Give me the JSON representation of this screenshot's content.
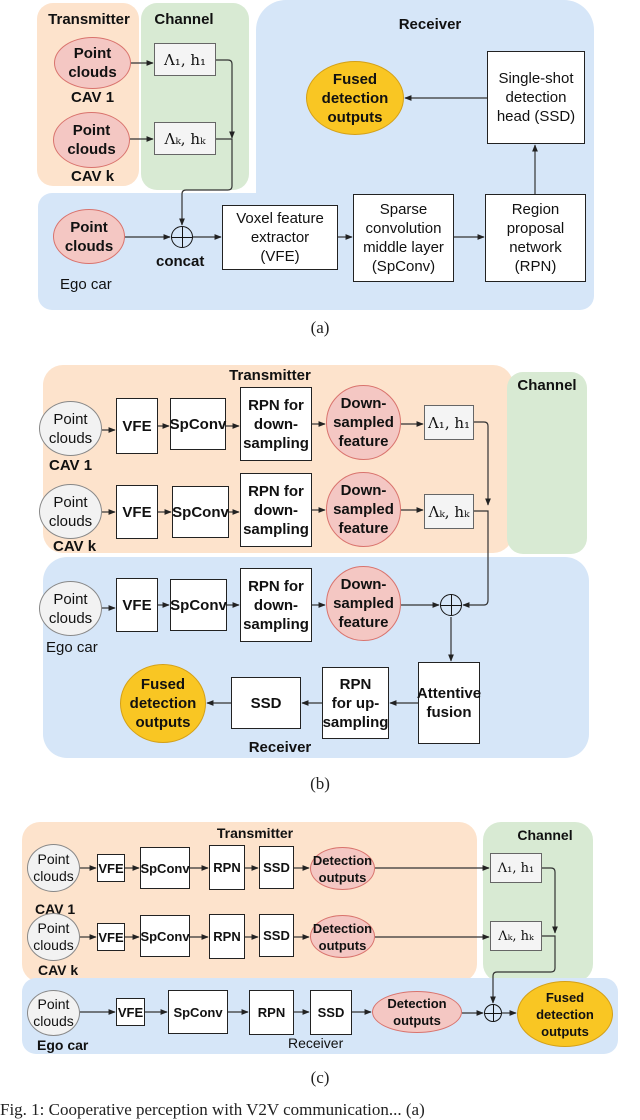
{
  "figure_caption_partial": "Fig. 1: Cooperative perception with V2V communication... (a)",
  "panel_a": {
    "caption": "(a)",
    "transmitter_title": "Transmitter",
    "channel_title": "Channel",
    "receiver_title": "Receiver",
    "cav1_node": "Point\nclouds",
    "cav1_label": "CAV 1",
    "cavk_node": "Point\nclouds",
    "cavk_label": "CAV k",
    "lambda1": "Λ₁, h₁",
    "lambdak": "Λₖ, hₖ",
    "ego_node": "Point\nclouds",
    "ego_label": "Ego car",
    "concat_label": "concat",
    "vfe": "Voxel feature\nextractor\n(VFE)",
    "spconv": "Sparse\nconvolution\nmiddle layer\n(SpConv)",
    "rpn": "Region\nproposal\nnetwork\n(RPN)",
    "ssd": "Single-shot\ndetection\nhead (SSD)",
    "output": "Fused\ndetection\noutputs"
  },
  "panel_b": {
    "caption": "(b)",
    "transmitter_title": "Transmitter",
    "channel_title": "Channel",
    "receiver_title": "Receiver",
    "point_clouds": "Point\nclouds",
    "cav1_label": "CAV 1",
    "cavk_label": "CAV k",
    "ego_label": "Ego car",
    "vfe": "VFE",
    "spconv": "SpConv",
    "rpn_down": "RPN for\ndown-\nsampling",
    "down_feature": "Down-\nsampled\nfeature",
    "lambda1": "Λ₁, h₁",
    "lambdak": "Λₖ, hₖ",
    "attentive": "Attentive\nfusion",
    "rpn_up": "RPN\nfor up-\nsampling",
    "ssd": "SSD",
    "output": "Fused\ndetection\noutputs"
  },
  "panel_c": {
    "caption": "(c)",
    "transmitter_title": "Transmitter",
    "channel_title": "Channel",
    "receiver_title": "Receiver",
    "point_clouds": "Point\nclouds",
    "cav1_label": "CAV 1",
    "cavk_label": "CAV k",
    "ego_label": "Ego car",
    "vfe": "VFE",
    "spconv": "SpConv",
    "rpn": "RPN",
    "ssd": "SSD",
    "detection": "Detection\noutputs",
    "lambda1": "Λ₁, h₁",
    "lambdak": "Λₖ, hₖ",
    "output": "Fused\ndetection\noutputs"
  }
}
